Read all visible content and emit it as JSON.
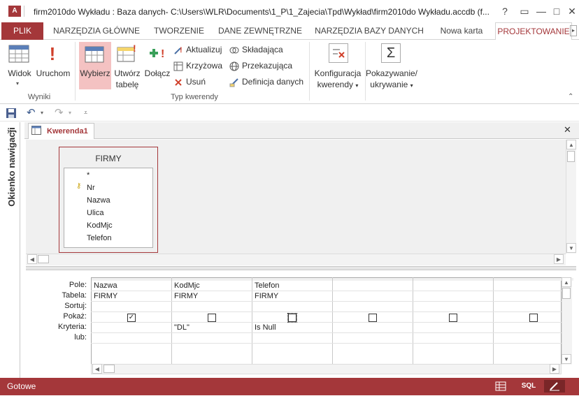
{
  "window": {
    "app_icon_label": "A",
    "title": "firm2010do Wykładu : Baza danych- C:\\Users\\WLR\\Documents\\1_P\\1_Zajecia\\Tpd\\Wykład\\firm2010do Wykładu.accdb (f...",
    "help_label": "?",
    "restore_label": "▭",
    "minimize_label": "—",
    "maximize_label": "□",
    "close_label": "✕"
  },
  "ribbon_tabs": [
    "PLIK",
    "NARZĘDZIA GŁÓWNE",
    "TWORZENIE",
    "DANE ZEWNĘTRZNE",
    "NARZĘDZIA BAZY DANYCH",
    "Nowa karta",
    "PROJEKTOWANIE"
  ],
  "ribbon": {
    "widok": "Widok",
    "uruchom": "Uruchom",
    "group_results": "Wyniki",
    "wybierz": "Wybierz",
    "utworz_1": "Utwórz",
    "utworz_2": "tabelę",
    "dolacz": "Dołącz",
    "aktualizuj": "Aktualizuj",
    "krzyzowa": "Krzyżowa",
    "usun": "Usuń",
    "skladajaca": "Składająca",
    "przekazujaca": "Przekazująca",
    "definicja": "Definicja danych",
    "group_type": "Typ kwerendy",
    "konfiguracja_1": "Konfiguracja",
    "konfiguracja_2": "kwerendy",
    "pokazywanie_1": "Pokazywanie/",
    "pokazywanie_2": "ukrywanie"
  },
  "nav_pane": {
    "label": "Okienko nawigacji",
    "toggle": "»"
  },
  "document": {
    "tab_label": "Kwerenda1",
    "close_label": "✕"
  },
  "table": {
    "name": "FIRMY",
    "fields": [
      "*",
      "Nr",
      "Nazwa",
      "Ulica",
      "KodMjc",
      "Telefon"
    ]
  },
  "grid": {
    "row_labels": [
      "Pole:",
      "Tabela:",
      "Sortuj:",
      "Pokaż:",
      "Kryteria:",
      "lub:"
    ],
    "columns": [
      {
        "field": "Nazwa",
        "table": "FIRMY",
        "sort": "",
        "show": true,
        "criteria": "",
        "or": ""
      },
      {
        "field": "KodMjc",
        "table": "FIRMY",
        "sort": "",
        "show": false,
        "criteria": "\"DL\"",
        "or": ""
      },
      {
        "field": "Telefon",
        "table": "FIRMY",
        "sort": "",
        "show": false,
        "criteria": "Is Null",
        "or": ""
      },
      {
        "field": "",
        "table": "",
        "sort": "",
        "show": false,
        "criteria": "",
        "or": ""
      },
      {
        "field": "",
        "table": "",
        "sort": "",
        "show": false,
        "criteria": "",
        "or": ""
      },
      {
        "field": "",
        "table": "",
        "sort": "",
        "show": false,
        "criteria": "",
        "or": ""
      }
    ]
  },
  "status": {
    "text": "Gotowe",
    "sql_label": "SQL"
  },
  "colors": {
    "accent": "#a4373a"
  }
}
